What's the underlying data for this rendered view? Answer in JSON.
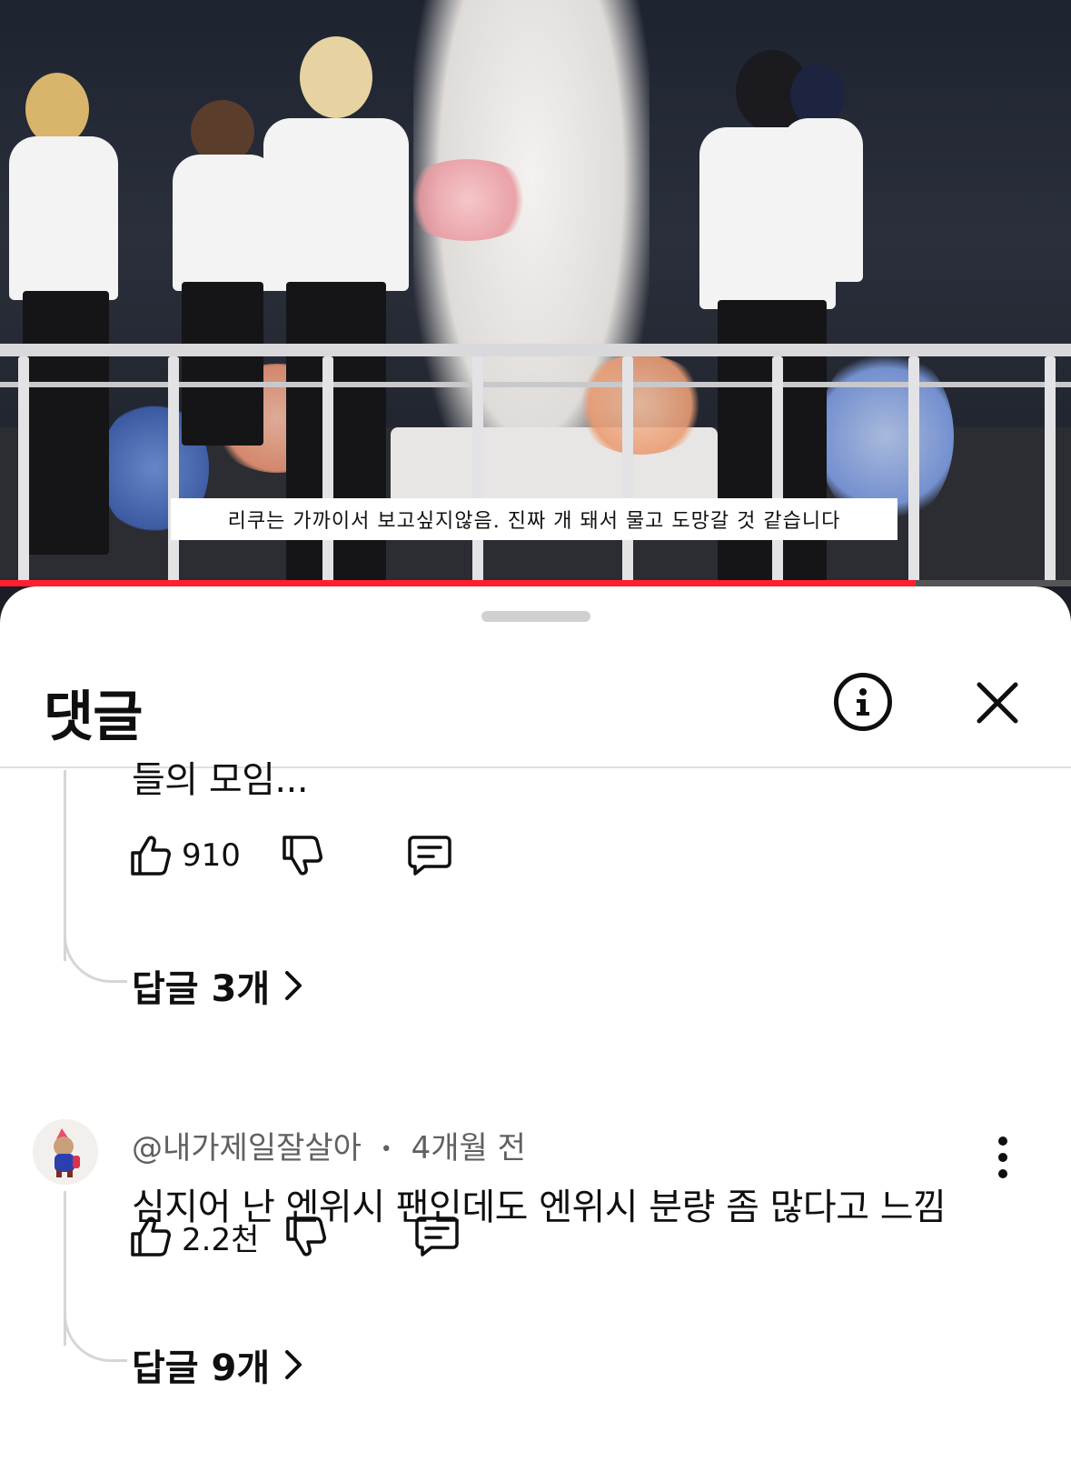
{
  "video": {
    "subtitle": "리쿠는 가까이서 보고싶지않음. 진짜 개 돼서 물고 도망갈 것 같습니다",
    "progress": 0.855,
    "progress_color": "#ff1f2e"
  },
  "sheet": {
    "title": "댓글",
    "info_icon": "info-icon",
    "close_icon": "close-icon"
  },
  "comments": [
    {
      "text_tail": "들의 모임...",
      "likes": "910",
      "replies_label": "답글 3개"
    },
    {
      "author": "@내가제일잘살아",
      "separator": "•",
      "time": "4개월 전",
      "text": "심지어 난 엔위시 팬인데도 엔위시 분량 좀 많다고 느낌",
      "likes": "2.2천",
      "replies_label": "답글 9개"
    }
  ]
}
